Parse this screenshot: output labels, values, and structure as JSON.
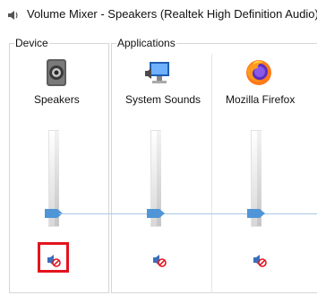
{
  "window": {
    "title": "Volume Mixer - Speakers (Realtek High Definition Audio)"
  },
  "device_group": {
    "label": "Device",
    "channel": {
      "name": "Speakers",
      "icon": "speaker-device-icon",
      "muted": true,
      "volume_level": 0.1
    }
  },
  "applications_group": {
    "label": "Applications",
    "channels": [
      {
        "name": "System Sounds",
        "icon": "system-sounds-icon",
        "muted": true,
        "volume_level": 0.1
      },
      {
        "name": "Mozilla Firefox",
        "icon": "firefox-icon",
        "muted": true,
        "volume_level": 0.1
      }
    ]
  },
  "colors": {
    "thumb": "#4f95d8",
    "highlight_border": "#e3141e",
    "mute_red": "#e3141e"
  }
}
